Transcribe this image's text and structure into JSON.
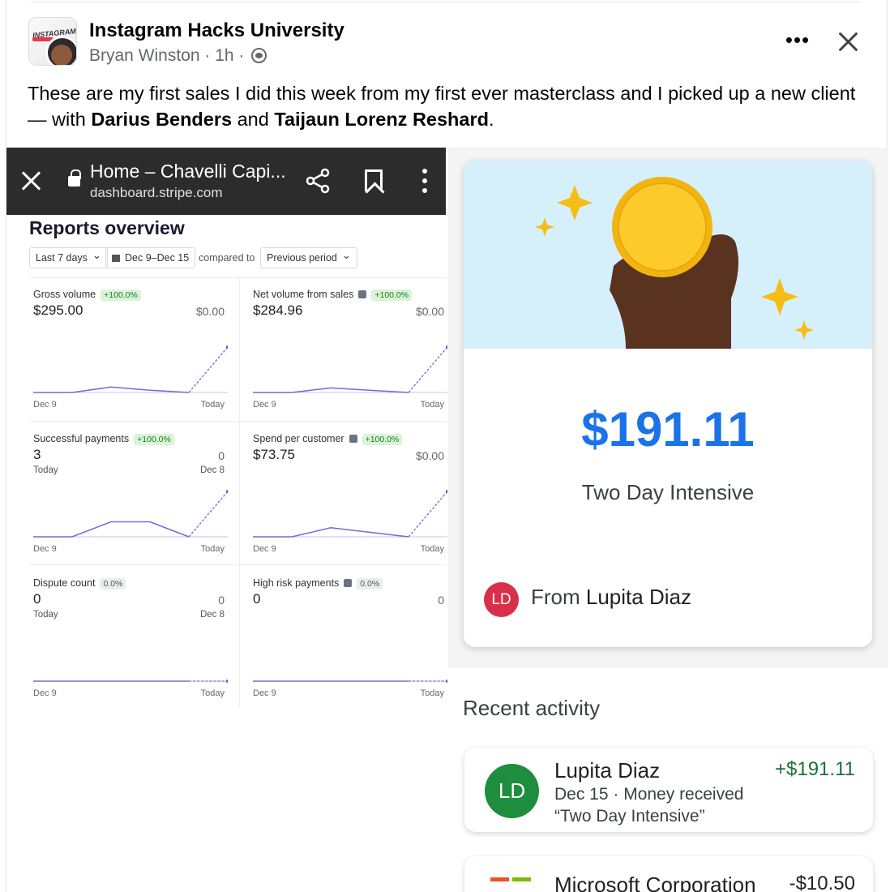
{
  "header": {
    "group_name": "Instagram Hacks University",
    "author": "Bryan Winston",
    "time": "1h",
    "separator": " · "
  },
  "post": {
    "text_before": "These are my first sales I did this week from my first ever masterclass and I picked up a new client — with ",
    "tag1": "Darius Benders",
    "text_and": " and ",
    "tag2": "Taijaun Lorenz Reshard",
    "text_end": "."
  },
  "avatar": {
    "logo_text": "INSTAGRAM"
  },
  "stripe": {
    "browser_title": "Home – Chavelli Capi...",
    "browser_url": "dashboard.stripe.com",
    "reports_title": "Reports overview",
    "filter_range": "Last 7 days",
    "filter_dates": "Dec 9–Dec 15",
    "compared_to": "compared to",
    "filter_period": "Previous period",
    "metrics": [
      {
        "label": "Gross volume",
        "badge": "+100.0%",
        "value": "$295.00",
        "prev": "$0.00",
        "x0": "Dec 9",
        "x1": "Today",
        "series": [
          0,
          0,
          0.12,
          0.05,
          0,
          1
        ]
      },
      {
        "label": "Net volume from sales",
        "badge": "+100.0%",
        "value": "$284.96",
        "prev": "$0.00",
        "x0": "Dec 9",
        "x1": "Today",
        "series": [
          0,
          0,
          0.1,
          0.05,
          0,
          1
        ]
      },
      {
        "label": "Successful payments",
        "badge": "+100.0%",
        "value": "3",
        "prev": "0",
        "sub_l": "Today",
        "sub_r": "Dec 8",
        "x0": "Dec 9",
        "x1": "Today",
        "series": [
          0,
          0,
          0.33,
          0.33,
          0,
          1
        ]
      },
      {
        "label": "Spend per customer",
        "badge": "+100.0%",
        "value": "$73.75",
        "prev": "$0.00",
        "x0": "Dec 9",
        "x1": "Today",
        "series": [
          0,
          0,
          0.2,
          0.1,
          0,
          1
        ]
      },
      {
        "label": "Dispute count",
        "badge": "0.0%",
        "value": "0",
        "prev": "0",
        "sub_l": "Today",
        "sub_r": "Dec 8",
        "x0": "Dec 9",
        "x1": "Today",
        "series": [
          0,
          0,
          0,
          0,
          0,
          0
        ]
      },
      {
        "label": "High risk payments",
        "badge": "0.0%",
        "value": "0",
        "prev": "0",
        "x0": "Dec 9",
        "x1": "Today",
        "series": [
          0,
          0,
          0,
          0,
          0,
          0
        ]
      }
    ]
  },
  "payment": {
    "amount": "$191.11",
    "description": "Two Day Intensive",
    "from_prefix": "From ",
    "from_name": "Lupita Diaz",
    "from_initials": "LD",
    "recent_title": "Recent activity",
    "activity": {
      "initials": "LD",
      "name": "Lupita Diaz",
      "amount": "+$191.11",
      "line2": "Dec 15 · Money received",
      "line3": "“Two Day Intensive”"
    },
    "activity2": {
      "name": "Microsoft Corporation",
      "amount": "-$10.50"
    }
  },
  "colors": {
    "accent_blue": "#1a73e8",
    "chart_line": "#7b68d8",
    "positive_green": "#1e6f3c",
    "from_avatar": "#d93049",
    "activity_avatar": "#1e8e3e"
  }
}
